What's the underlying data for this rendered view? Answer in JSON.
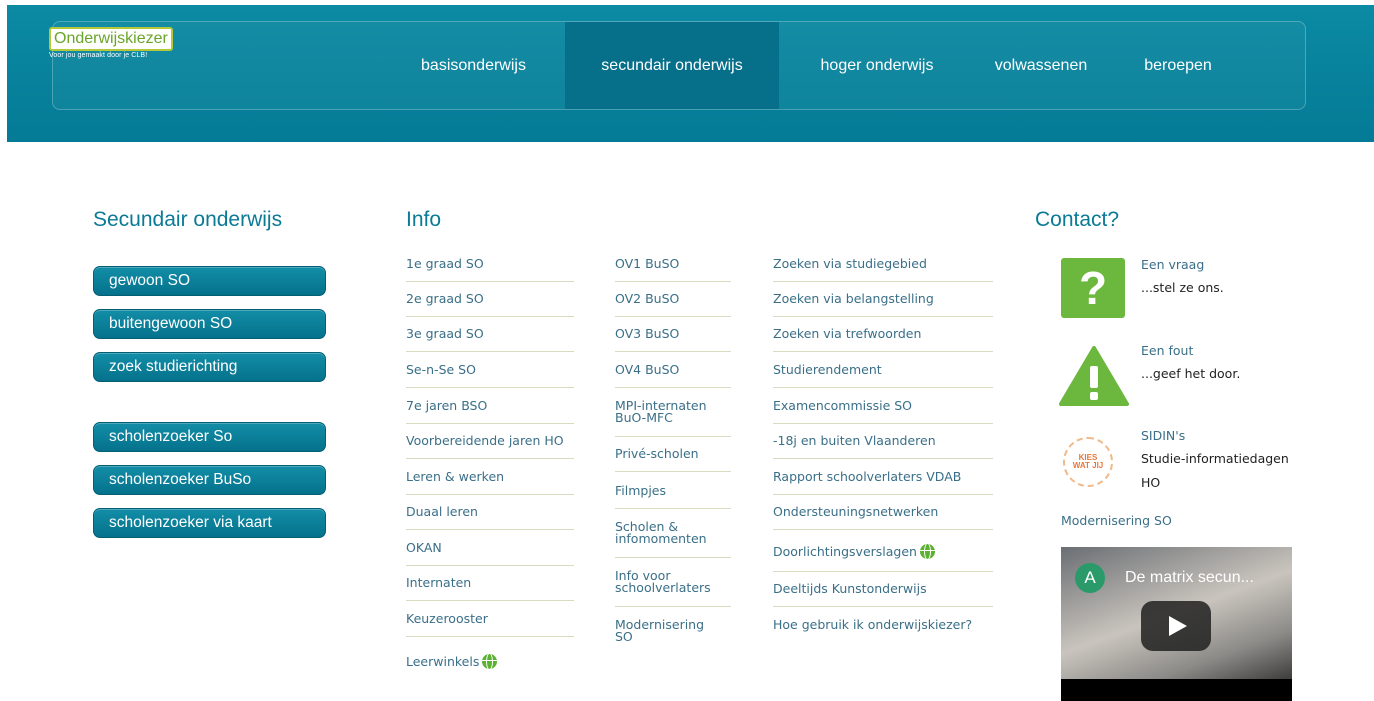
{
  "header": {
    "logo_main": "Onderwijskiezer",
    "logo_tagline": "Voor jou gemaakt door je CLB!",
    "nav": [
      {
        "label": "basisonderwijs",
        "active": false
      },
      {
        "label": "secundair onderwijs",
        "active": true
      },
      {
        "label": "hoger onderwijs",
        "active": false
      },
      {
        "label": "volwassenen",
        "active": false
      },
      {
        "label": "beroepen",
        "active": false
      }
    ]
  },
  "sidebar": {
    "title": "Secundair onderwijs",
    "buttons": [
      "gewoon SO",
      "buitengewoon SO",
      "zoek studierichting",
      "scholenzoeker So",
      "scholenzoeker BuSo",
      "scholenzoeker via kaart"
    ]
  },
  "info": {
    "title": "Info",
    "col1": [
      "1e graad SO",
      "2e graad SO",
      "3e graad SO",
      "Se-n-Se SO",
      "7e jaren BSO",
      "Voorbereidende jaren HO",
      "Leren & werken",
      "Duaal leren",
      "OKAN",
      "Internaten",
      "Keuzerooster",
      "Leerwinkels"
    ],
    "col2": [
      "OV1 BuSO",
      "OV2 BuSO",
      "OV3 BuSO",
      "OV4 BuSO",
      "MPI-internaten\nBuO-MFC",
      "Privé-scholen",
      "Filmpjes",
      "Scholen &\ninfomomenten",
      "Info voor\nschoolverlaters",
      "Modernisering\nSO"
    ],
    "col3": [
      "Zoeken via studiegebied",
      "Zoeken via belangstelling",
      "Zoeken via trefwoorden",
      "Studierendement",
      "Examencommissie SO",
      "-18j en buiten Vlaanderen",
      "Rapport schoolverlaters VDAB",
      "Ondersteuningsnetwerken",
      "Doorlichtingsverslagen",
      "Deeltijds Kunstonderwijs",
      "Hoe gebruik ik onderwijskiezer?"
    ]
  },
  "contact": {
    "title": "Contact?",
    "question_link": "Een vraag",
    "question_text": "...stel ze ons.",
    "error_link": "Een fout",
    "error_text": "...geef het door.",
    "sidin_link": "SIDIN's",
    "sidin_text": "Studie-informatiedagen HO",
    "sidin_badge": "KIES WAT JIJ",
    "modernisering_link": "Modernisering SO",
    "video_avatar": "A",
    "video_title": "De matrix secun..."
  },
  "colors": {
    "header": "#0c8aa3",
    "accent_title": "#0b7a95",
    "link": "#3a6f88",
    "green_icon": "#6cb73d"
  }
}
